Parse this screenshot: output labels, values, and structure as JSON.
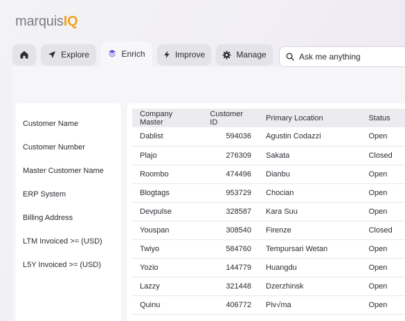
{
  "logo": {
    "part1": "marquis",
    "part2": "IQ"
  },
  "nav": {
    "home_icon": "home-icon",
    "explore_label": "Explore",
    "enrich_label": "Enrich",
    "improve_label": "Improve",
    "manage_label": "Manage"
  },
  "search": {
    "placeholder": "Ask me anything"
  },
  "sidebar": {
    "items": [
      {
        "label": "Customer Name"
      },
      {
        "label": "Customer Number"
      },
      {
        "label": "Master Customer Name"
      },
      {
        "label": "ERP System"
      },
      {
        "label": "Billing Address"
      },
      {
        "label": "LTM Invoiced >= (USD)"
      },
      {
        "label": "L5Y Invoiced >= (USD)"
      }
    ]
  },
  "table": {
    "headers": [
      "Company Master",
      "Customer ID",
      "Primary Location",
      "Status"
    ],
    "rows": [
      [
        "Dablist",
        "594036",
        "Agustin Codazzi",
        "Open"
      ],
      [
        "Plajo",
        "276309",
        "Sakata",
        "Closed"
      ],
      [
        "Roombo",
        "474496",
        "Dianbu",
        "Open"
      ],
      [
        "Blogtags",
        "953729",
        "Chocian",
        "Open"
      ],
      [
        "Devpulse",
        "328587",
        "Kara Suu",
        "Open"
      ],
      [
        "Youspan",
        "308540",
        "Firenze",
        "Closed"
      ],
      [
        "Twiyo",
        "584760",
        "Tempursari Wetan",
        "Open"
      ],
      [
        "Yozio",
        "144779",
        "Huangdu",
        "Open"
      ],
      [
        "Lazzy",
        "321448",
        "Dzerzhinsk",
        "Open"
      ],
      [
        "Quinu",
        "406772",
        "Piv√ma",
        "Open"
      ]
    ]
  },
  "colors": {
    "brand_gray": "#7a7c86",
    "brand_accent": "#f0a41e",
    "enrich_accent": "#6b4fd8"
  }
}
